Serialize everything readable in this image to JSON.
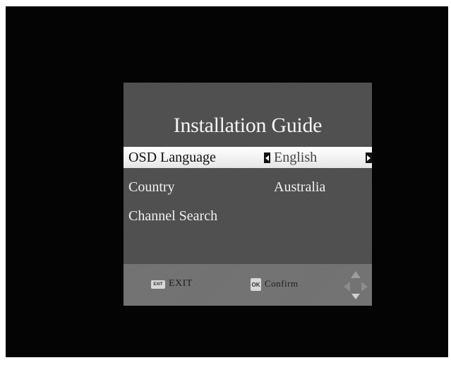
{
  "dialog": {
    "title": "Installation Guide",
    "rows": [
      {
        "label": "OSD Language",
        "value": "English",
        "selected": true
      },
      {
        "label": "Country",
        "value": "Australia",
        "selected": false
      },
      {
        "label": "Channel Search",
        "value": "",
        "selected": false
      }
    ]
  },
  "footer": {
    "exit_key": "EXIT",
    "exit_label": "EXIT",
    "ok_key": "OK",
    "confirm_label": "Confirm"
  },
  "icons": {
    "arrow_left": "left-arrow-icon",
    "arrow_right": "right-arrow-icon",
    "nav_pad": "navigation-pad-icon"
  },
  "colors": {
    "screen_bg": "#040404",
    "dialog_bg": "#4e4e4e",
    "footer_bg": "#707070",
    "selected_bg": "#ffffff"
  }
}
